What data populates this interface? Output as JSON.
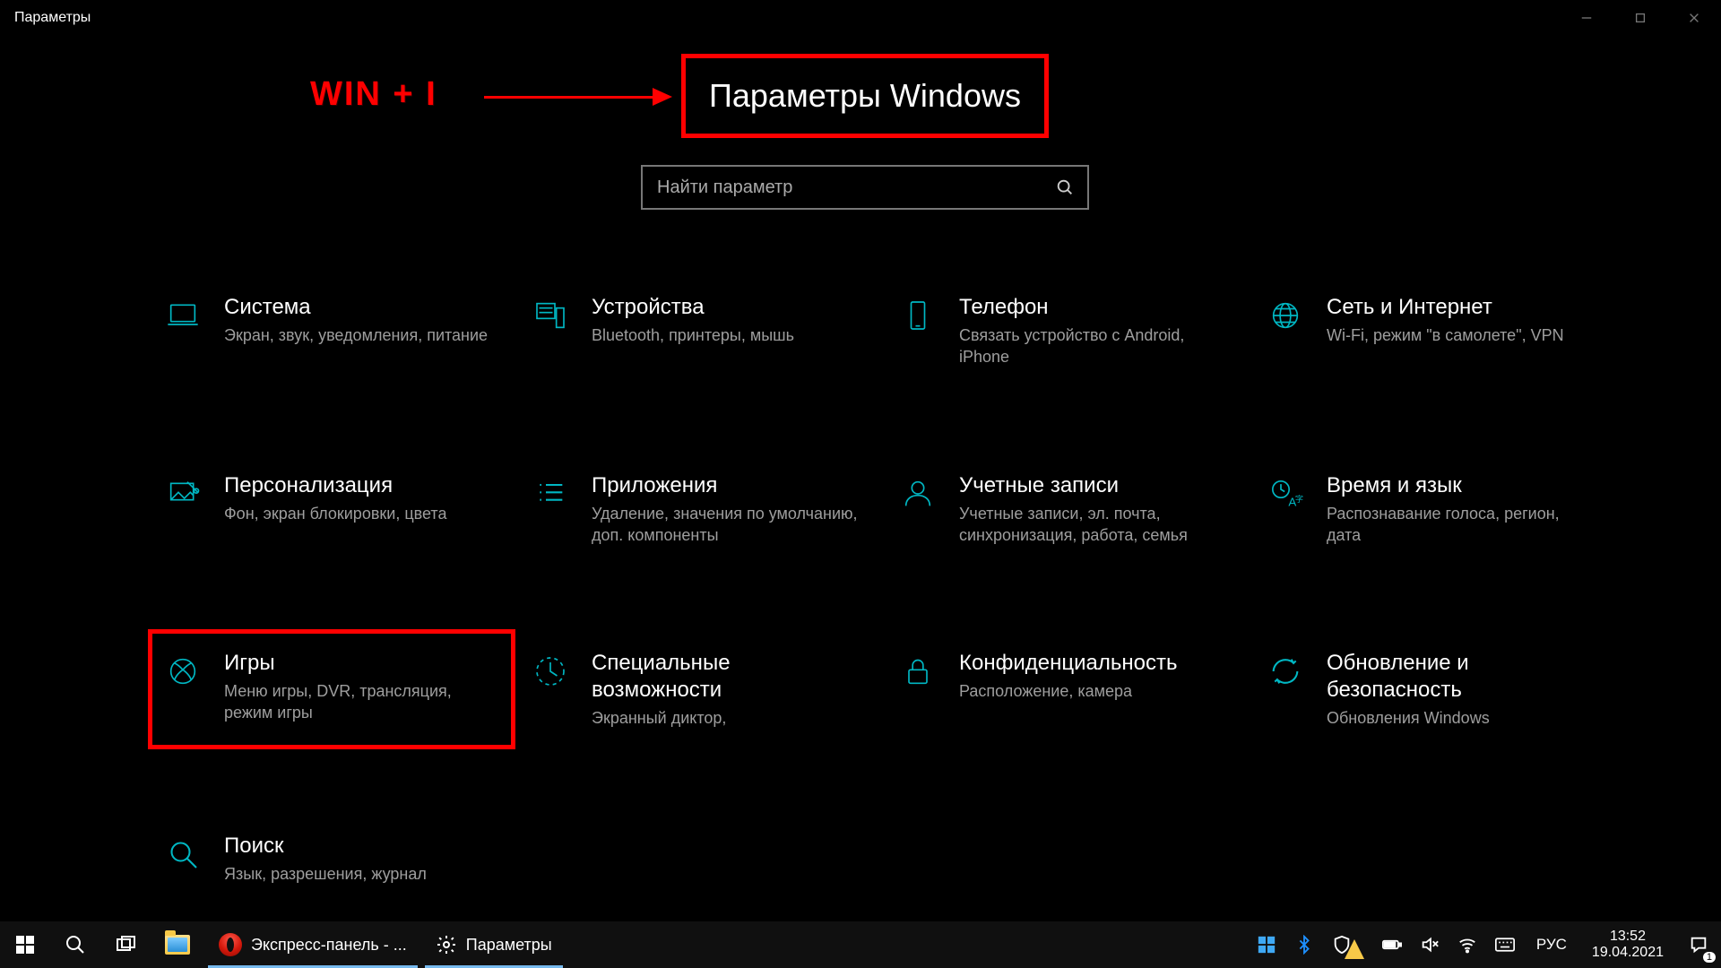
{
  "window": {
    "title": "Параметры"
  },
  "annotation": {
    "shortcut": "WIN + I"
  },
  "page_title": "Параметры Windows",
  "search": {
    "placeholder": "Найти параметр"
  },
  "tiles": [
    {
      "id": "system",
      "title": "Система",
      "desc": "Экран, звук, уведомления, питание",
      "highlighted": false
    },
    {
      "id": "devices",
      "title": "Устройства",
      "desc": "Bluetooth, принтеры, мышь",
      "highlighted": false
    },
    {
      "id": "phone",
      "title": "Телефон",
      "desc": "Связать устройство с Android, iPhone",
      "highlighted": false
    },
    {
      "id": "network",
      "title": "Сеть и Интернет",
      "desc": "Wi-Fi, режим \"в самолете\", VPN",
      "highlighted": false
    },
    {
      "id": "personalize",
      "title": "Персонализация",
      "desc": "Фон, экран блокировки, цвета",
      "highlighted": false
    },
    {
      "id": "apps",
      "title": "Приложения",
      "desc": "Удаление, значения по умолчанию, доп. компоненты",
      "highlighted": false
    },
    {
      "id": "accounts",
      "title": "Учетные записи",
      "desc": "Учетные записи, эл. почта, синхронизация, работа, семья",
      "highlighted": false
    },
    {
      "id": "timelang",
      "title": "Время и язык",
      "desc": "Распознавание голоса, регион, дата",
      "highlighted": false
    },
    {
      "id": "gaming",
      "title": "Игры",
      "desc": "Меню игры, DVR, трансляция, режим игры",
      "highlighted": true
    },
    {
      "id": "ease",
      "title": "Специальные возможности",
      "desc": "Экранный диктор,",
      "highlighted": false
    },
    {
      "id": "privacy",
      "title": "Конфиденциальность",
      "desc": "Расположение, камера",
      "highlighted": false
    },
    {
      "id": "update",
      "title": "Обновление и безопасность",
      "desc": "Обновления Windows",
      "highlighted": false
    },
    {
      "id": "search",
      "title": "Поиск",
      "desc": "Язык, разрешения, журнал",
      "highlighted": false
    }
  ],
  "taskbar": {
    "apps": [
      {
        "id": "opera",
        "label": "Экспресс-панель - ..."
      },
      {
        "id": "settings",
        "label": "Параметры"
      }
    ],
    "language": "РУС",
    "time": "13:52",
    "date": "19.04.2021",
    "notifications": "1"
  },
  "colors": {
    "accent": "#00b7c3",
    "highlight": "#ff0000"
  }
}
